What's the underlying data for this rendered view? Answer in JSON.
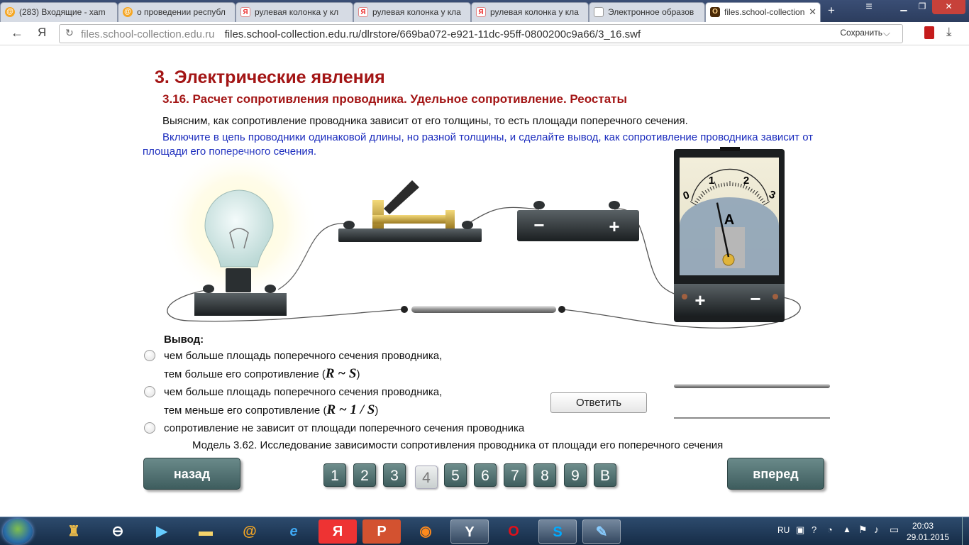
{
  "browser": {
    "tabs": [
      {
        "label": "(283) Входящие - xam",
        "icon": "mail-icon"
      },
      {
        "label": "о проведении республ",
        "icon": "mail-icon"
      },
      {
        "label": "рулевая колонка у кл",
        "icon": "yandex-icon"
      },
      {
        "label": "рулевая колонка у кла",
        "icon": "yandex-icon"
      },
      {
        "label": "рулевая колонка у кла",
        "icon": "yandex-icon"
      },
      {
        "label": "Электронное образов",
        "icon": "document-icon"
      },
      {
        "label": "files.school-collection",
        "icon": "opera-icon"
      }
    ],
    "back_glyph": "←",
    "yandex_glyph": "Я",
    "host": "files.school-collection.edu.ru",
    "url": "files.school-collection.edu.ru/dlrstore/669ba072-e921-11dc-95ff-0800200c9a66/3_16.swf",
    "save_label": "Сохранить"
  },
  "content": {
    "chapter_title": "3. Электрические явления",
    "section_title": "3.16. Расчет сопротивления проводника. Удельное сопротивление. Реостаты",
    "intro": "Выясним, как сопротивление проводника зависит от его толщины, то есть площади поперечного сечения.",
    "task": "Включите в цепь проводники одинаковой длины, но разной толщины, и сделайте вывод, как сопротивление проводника зависит от площади его поперечного сечения.",
    "ammeter": {
      "scale_labels": [
        "0",
        "1",
        "2",
        "3"
      ],
      "unit": "A",
      "plus": "+",
      "minus": "−",
      "reading": 1.2
    },
    "battery": {
      "minus": "−",
      "plus": "+"
    },
    "conclusion_label": "Вывод:",
    "options": [
      {
        "line1": "чем больше площадь поперечного сечения проводника,",
        "line2": "тем больше его сопротивление (",
        "formula": "R ~ S",
        "close": ")"
      },
      {
        "line1": "чем больше площадь поперечного сечения проводника,",
        "line2": "тем меньше его сопротивление (",
        "formula": "R ~ 1 / S",
        "close": ")"
      },
      {
        "line1": "сопротивление не зависит от площади поперечного сечения проводника"
      }
    ],
    "answer_button": "Ответить",
    "caption": "Модель 3.62. Исследование зависимости сопротивления проводника от площади его поперечного сечения"
  },
  "nav": {
    "back": "назад",
    "forward": "вперед",
    "pages": [
      "1",
      "2",
      "3",
      "4",
      "5",
      "6",
      "7",
      "8",
      "9",
      "B"
    ],
    "current_page": "4"
  },
  "taskbar": {
    "lang": "RU",
    "time": "20:03",
    "date": "29.01.2015"
  }
}
